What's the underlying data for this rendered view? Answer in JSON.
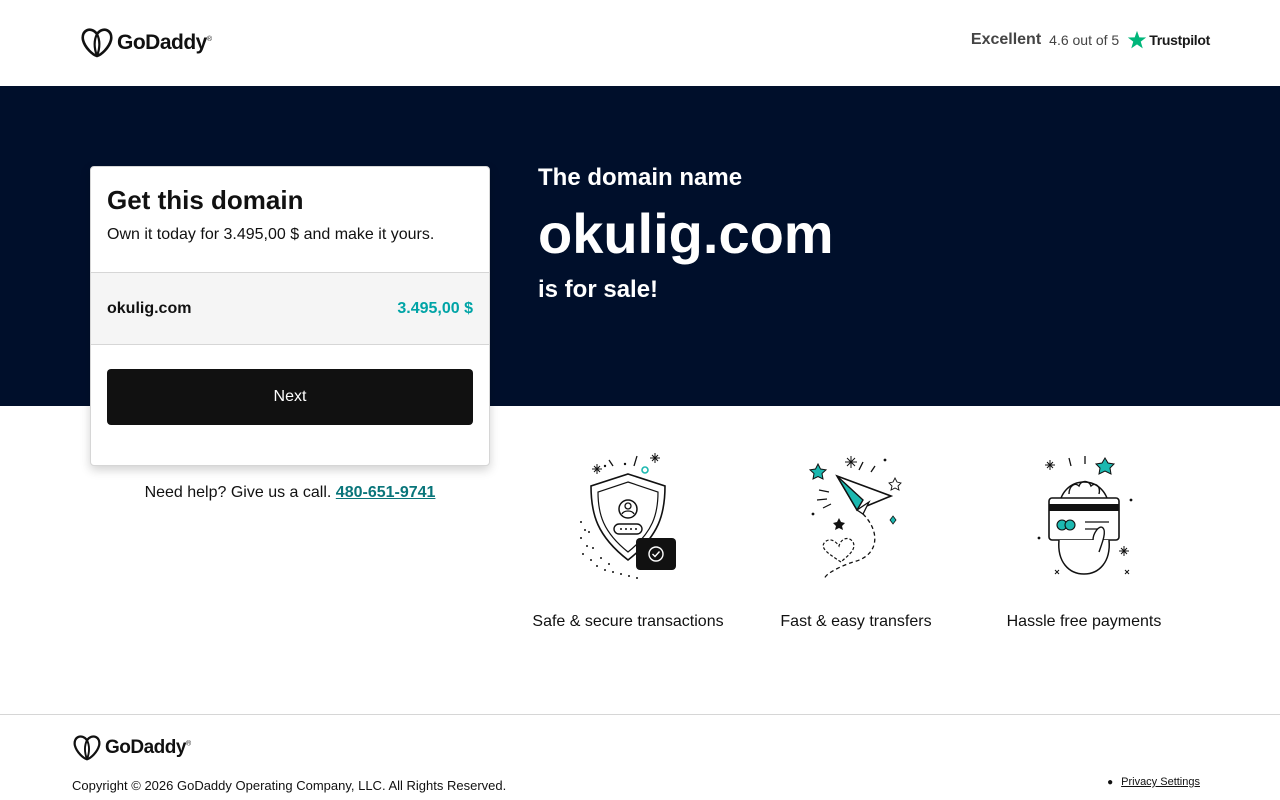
{
  "header": {
    "logo_text": "GoDaddy",
    "trustpilot": {
      "rating_word": "Excellent",
      "score": "4.6 out of 5",
      "brand": "Trustpilot"
    }
  },
  "hero": {
    "line1": "The domain name",
    "domain": "okulig.com",
    "line2": "is for sale!"
  },
  "card": {
    "title": "Get this domain",
    "description": "Own it today for 3.495,00 $ and make it yours.",
    "row_domain": "okulig.com",
    "row_price": "3.495,00 $",
    "button_label": "Next"
  },
  "help": {
    "text": "Need help? Give us a call.",
    "phone": "480-651-9741"
  },
  "features": [
    {
      "icon": "secure-shield-icon",
      "label": "Safe & secure transactions"
    },
    {
      "icon": "paper-plane-icon",
      "label": "Fast & easy transfers"
    },
    {
      "icon": "card-payment-icon",
      "label": "Hassle free payments"
    }
  ],
  "footer": {
    "logo_text": "GoDaddy",
    "copyright": "Copyright © 2026 GoDaddy Operating Company, LLC. All Rights Reserved.",
    "privacy_label": "Privacy Settings"
  },
  "colors": {
    "hero_bg": "#000f2b",
    "price_teal": "#00a4a6",
    "link_teal": "#09757a",
    "button_bg": "#111111",
    "trustpilot_green": "#00b67a"
  }
}
